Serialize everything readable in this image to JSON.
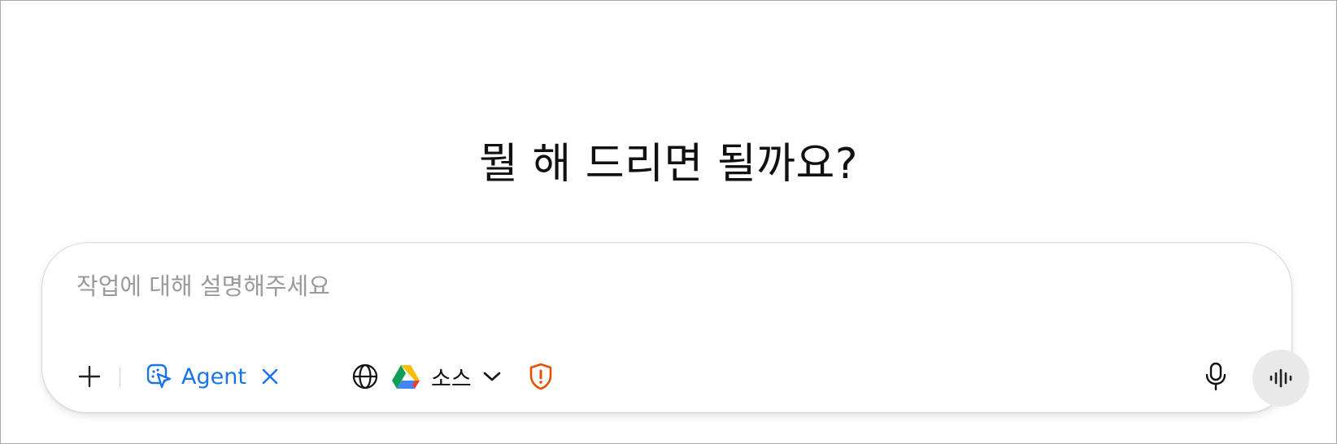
{
  "heading": "뭘 해 드리면 될까요?",
  "composer": {
    "placeholder": "작업에 대해 설명해주세요",
    "value": ""
  },
  "toolbar": {
    "add_icon": "plus-icon",
    "agent": {
      "label": "Agent",
      "icon": "agent-cursor-icon",
      "remove_icon": "close-icon",
      "accent": "#1a73e8"
    },
    "web_icon": "globe-icon",
    "drive_icon": "google-drive-icon",
    "sources_label": "소스",
    "sources_chevron": "chevron-down-icon",
    "privacy_icon": "shield-alert-icon",
    "privacy_color": "#e65100",
    "mic_icon": "microphone-icon",
    "voice_icon": "voice-waveform-icon"
  }
}
